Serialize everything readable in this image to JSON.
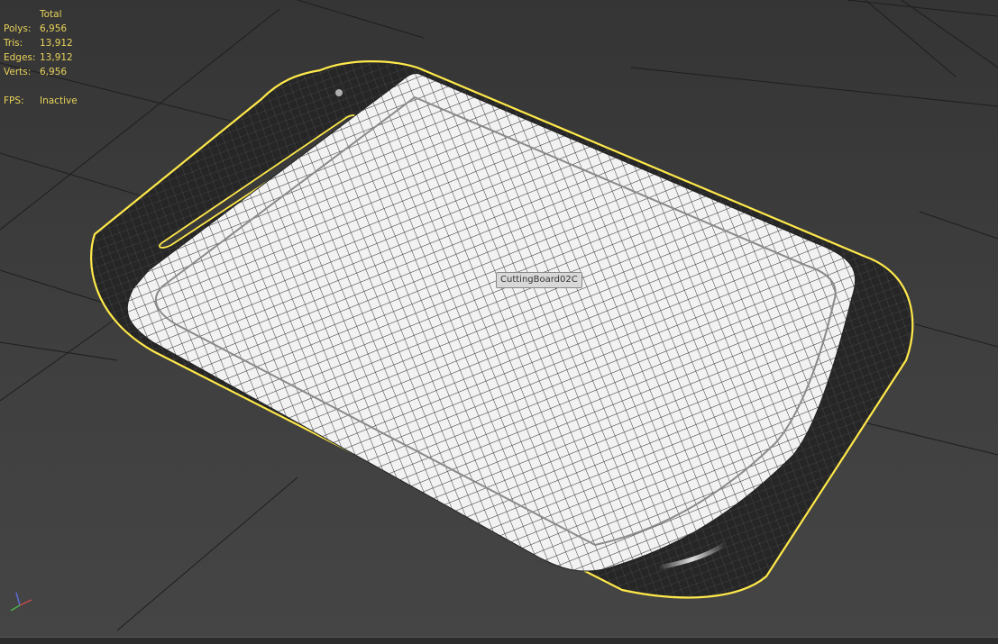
{
  "viewport": {
    "background": "#3d3d3d",
    "selection_color": "#ffe94a",
    "stat_color": "#e8d35a"
  },
  "stats": {
    "header": "Total",
    "rows": [
      {
        "label": "Polys:",
        "value": "6,956"
      },
      {
        "label": "Tris:",
        "value": "13,912"
      },
      {
        "label": "Edges:",
        "value": "13,912"
      },
      {
        "label": "Verts:",
        "value": "6,956"
      }
    ],
    "fps_label": "FPS:",
    "fps_value": "Inactive"
  },
  "object": {
    "name": "CuttingBoard02C"
  },
  "axis_gizmo": {
    "axes": [
      "z-axis",
      "x-axis",
      "y-axis"
    ]
  }
}
